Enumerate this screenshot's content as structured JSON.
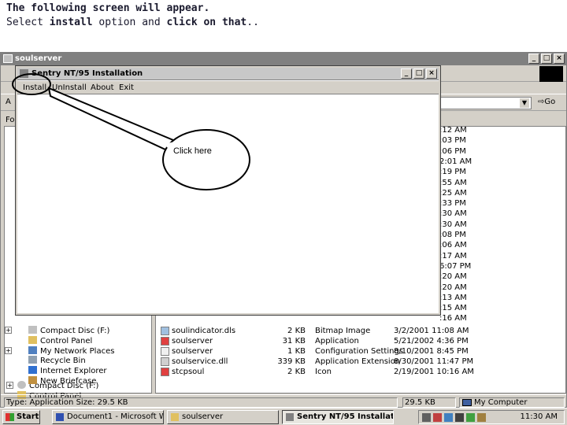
{
  "slide": {
    "title": "The following screen will appear.",
    "subtitle_parts": [
      "Select ",
      "install",
      " option and ",
      "click on that",
      ".."
    ]
  },
  "explorer": {
    "title": "soulserver",
    "address_label": "A",
    "go_label": "Go",
    "folders_label": "Fol",
    "tree": [
      {
        "label": "Compact Disc (F:)",
        "icon": "cd-icon",
        "expander": "+"
      },
      {
        "label": "Control Panel",
        "icon": "control-panel-icon",
        "expander": ""
      },
      {
        "label": "My Network Places",
        "icon": "network-icon",
        "expander": "+"
      },
      {
        "label": "Recycle Bin",
        "icon": "recycle-bin-icon",
        "expander": ""
      },
      {
        "label": "Internet Explorer",
        "icon": "ie-icon",
        "expander": ""
      },
      {
        "label": "New Briefcase",
        "icon": "briefcase-icon",
        "expander": ""
      }
    ],
    "files": [
      {
        "name": "soulindicator.dls",
        "size": "2 KB",
        "type": "Bitmap Image",
        "modified": "3/2/2001 11:08 AM"
      },
      {
        "name": "soulserver",
        "size": "31 KB",
        "type": "Application",
        "modified": "5/21/2002 4:36 PM"
      },
      {
        "name": "soulserver",
        "size": "1 KB",
        "type": "Configuration Settings",
        "modified": "8/10/2001 8:45 PM"
      },
      {
        "name": "soulservice.dll",
        "size": "339 KB",
        "type": "Application Extension",
        "modified": "8/30/2001 11:47 PM"
      },
      {
        "name": "stcpsoul",
        "size": "2 KB",
        "type": "Icon",
        "modified": "2/19/2001 10:16 AM"
      }
    ],
    "times": [
      ":12 AM",
      ":03 PM",
      ":06 PM",
      "2:01 AM",
      ":19 PM",
      ":55 AM",
      ":25 AM",
      ":33 PM",
      ":30 AM",
      ":30 AM",
      ":08 PM",
      ":06 AM",
      ":17 AM",
      "6:07 PM",
      ":20 AM",
      ":20 AM",
      ":13 AM",
      ":15 AM",
      ":16 AM"
    ],
    "status_type": "Type: Application Size: 29.5 KB",
    "status_size": "29.5 KB",
    "status_location": "My Computer"
  },
  "dialog": {
    "title": "Sentry NT/95 Installation",
    "menu": [
      "Install",
      "UnInstall",
      "About",
      "Exit"
    ]
  },
  "callout": {
    "text": "Click here"
  },
  "taskbar": {
    "start_label": "Start",
    "tasks": [
      "Document1 - Microsoft W...",
      "soulserver",
      "Sentry NT/95 Installat..."
    ],
    "clock": "11:30 AM"
  },
  "colors": {
    "accent": "#1a1a2e",
    "window_face": "#d4d0c8",
    "titlebar": "#808080"
  }
}
